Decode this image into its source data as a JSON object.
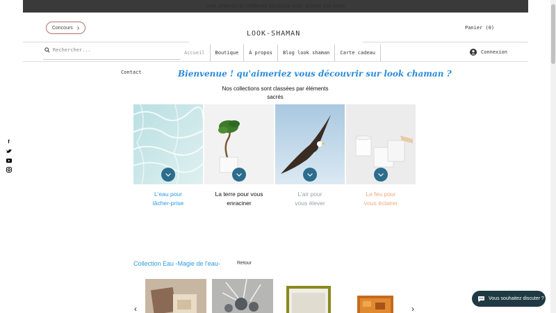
{
  "banner": {
    "text": "look shaman la meilleure boutique pour activer vos sens"
  },
  "header": {
    "concours_label": "Concours",
    "logo": "LOOK-SHAMAN",
    "cart_label": "Panier (0)",
    "search_placeholder": "Rechercher...",
    "login_label": "Connexion"
  },
  "nav": {
    "items": [
      {
        "label": "Accueil"
      },
      {
        "label": "Boutique"
      },
      {
        "label": "À propos"
      },
      {
        "label": "Blog look shaman"
      },
      {
        "label": "Carte cadeau"
      }
    ],
    "contact": "Contact"
  },
  "social": {
    "icons": [
      "facebook-icon",
      "twitter-icon",
      "youtube-icon",
      "instagram-icon"
    ]
  },
  "main": {
    "welcome": "Bienvenue  ! qu'aimeriez vous découvrir sur look chaman ?",
    "subtitle": "Nos collections sont classées par éléments sacrés",
    "cards": [
      {
        "line1": "L'eau pour",
        "line2": "lâcher-prise",
        "color": "#2a9be0"
      },
      {
        "line1": "La terre pour vous",
        "line2": "enraciner",
        "color": "#111111"
      },
      {
        "line1": "L'air pour",
        "line2": "vous élever",
        "color": "#9aa0a6"
      },
      {
        "line1": "Le feu pour",
        "line2": "vous éclairer",
        "color": "#f2a77c"
      }
    ]
  },
  "collection": {
    "title": "Collection Eau -Magie de l'eau-",
    "back": "Retour"
  },
  "chat": {
    "label": "Vous souhaitez discuter ?"
  },
  "colors": {
    "accent_blue": "#2a9be0",
    "chat_bg": "#1f3a42",
    "arrow_btn": "#2c6c8c"
  }
}
